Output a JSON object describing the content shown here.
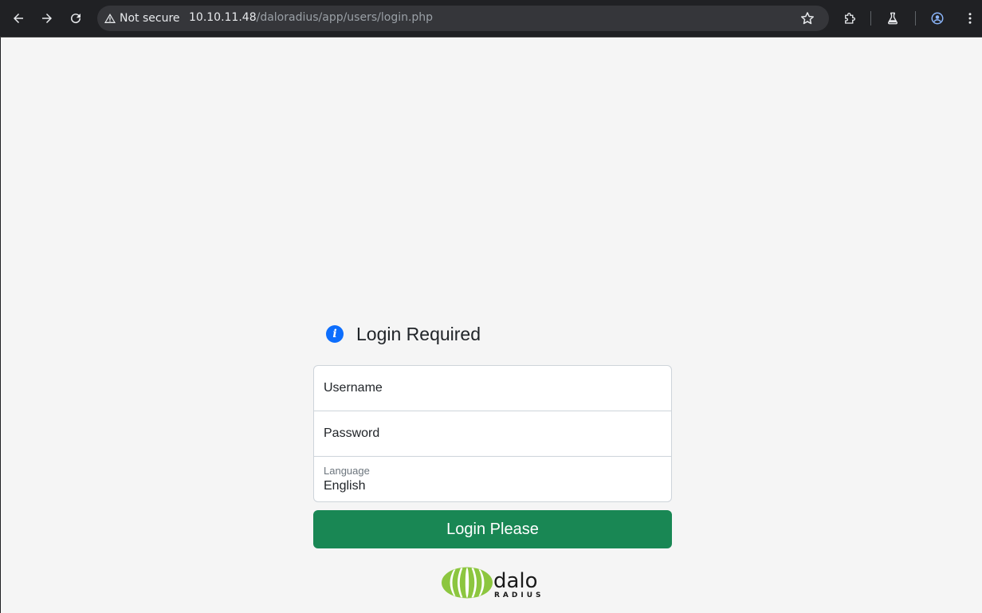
{
  "browser": {
    "security_label": "Not secure",
    "url_host": "10.10.11.48",
    "url_path": "/daloradius/app/users/login.php",
    "icons": [
      "back-icon",
      "forward-icon",
      "reload-icon",
      "warning-icon",
      "star-icon",
      "extensions-icon",
      "labs-icon",
      "profile-icon",
      "menu-icon"
    ]
  },
  "login": {
    "title": "Login Required",
    "username_placeholder": "Username",
    "password_placeholder": "Password",
    "language_label": "Language",
    "language_value": "English",
    "submit_label": "Login Please"
  },
  "colors": {
    "accent_green": "#198754",
    "info_blue": "#0d6efd",
    "logo_green": "#8cc63f"
  }
}
